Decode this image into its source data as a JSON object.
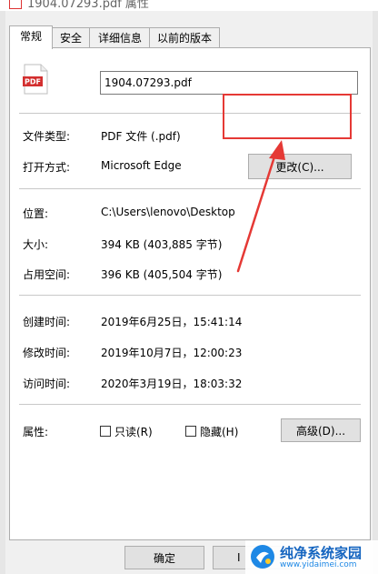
{
  "window": {
    "title": "1904.07293.pdf 属性"
  },
  "tabs": [
    {
      "label": "常规",
      "active": true
    },
    {
      "label": "安全",
      "active": false
    },
    {
      "label": "详细信息",
      "active": false
    },
    {
      "label": "以前的版本",
      "active": false
    }
  ],
  "file": {
    "name": "1904.07293.pdf",
    "icon": "pdf-file-icon"
  },
  "type_row": {
    "label": "文件类型:",
    "value": "PDF 文件 (.pdf)"
  },
  "open_with_row": {
    "label": "打开方式:",
    "value": "Microsoft Edge",
    "button": "更改(C)..."
  },
  "location_row": {
    "label": "位置:",
    "value": "C:\\Users\\lenovo\\Desktop"
  },
  "size_row": {
    "label": "大小:",
    "value": "394 KB (403,885 字节)"
  },
  "disk_row": {
    "label": "占用空间:",
    "value": "396 KB (405,504 字节)"
  },
  "created_row": {
    "label": "创建时间:",
    "value": "2019年6月25日，15:41:14"
  },
  "modified_row": {
    "label": "修改时间:",
    "value": "2019年10月7日，12:00:23"
  },
  "accessed_row": {
    "label": "访问时间:",
    "value": "2020年3月19日，18:03:32"
  },
  "attributes": {
    "label": "属性:",
    "readonly": "只读(R)",
    "hidden": "隐藏(H)",
    "advanced": "高级(D)..."
  },
  "footer": {
    "ok": "确定",
    "cancel_partial": "I"
  },
  "watermark": {
    "title": "纯净系统家园",
    "url": "www.yidaimei.com"
  },
  "colors": {
    "highlight": "#e53935",
    "watermark": "#1565c0"
  }
}
